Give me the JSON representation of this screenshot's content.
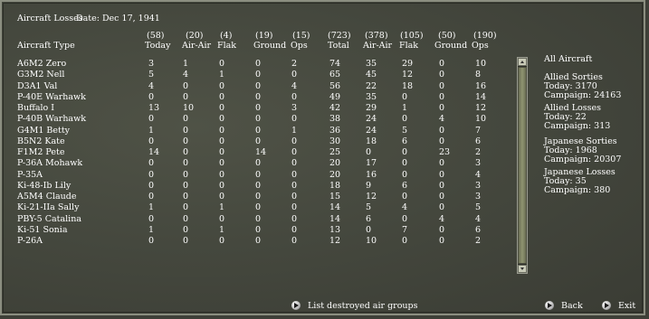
{
  "window": {
    "title": "Aircraft Losses",
    "date": "Date: Dec 17, 1941"
  },
  "columns": {
    "totals": [
      "(58)",
      "(20)",
      "(4)",
      "(19)",
      "(15)",
      "(723)",
      "(378)",
      "(105)",
      "(50)",
      "(190)"
    ],
    "labels": [
      "Aircraft Type",
      "Today",
      "Air-Air",
      "Flak",
      "Ground",
      "Ops",
      "Total",
      "Air-Air",
      "Flak",
      "Ground",
      "Ops"
    ]
  },
  "rows": [
    [
      "A6M2 Zero",
      "3",
      "1",
      "0",
      "0",
      "2",
      "74",
      "35",
      "29",
      "0",
      "10"
    ],
    [
      "G3M2 Nell",
      "5",
      "4",
      "1",
      "0",
      "0",
      "65",
      "45",
      "12",
      "0",
      "8"
    ],
    [
      "D3A1 Val",
      "4",
      "0",
      "0",
      "0",
      "4",
      "56",
      "22",
      "18",
      "0",
      "16"
    ],
    [
      "P-40E Warhawk",
      "0",
      "0",
      "0",
      "0",
      "0",
      "49",
      "35",
      "0",
      "0",
      "14"
    ],
    [
      "Buffalo I",
      "13",
      "10",
      "0",
      "0",
      "3",
      "42",
      "29",
      "1",
      "0",
      "12"
    ],
    [
      "P-40B Warhawk",
      "0",
      "0",
      "0",
      "0",
      "0",
      "38",
      "24",
      "0",
      "4",
      "10"
    ],
    [
      "G4M1 Betty",
      "1",
      "0",
      "0",
      "0",
      "1",
      "36",
      "24",
      "5",
      "0",
      "7"
    ],
    [
      "B5N2 Kate",
      "0",
      "0",
      "0",
      "0",
      "0",
      "30",
      "18",
      "6",
      "0",
      "6"
    ],
    [
      "F1M2 Pete",
      "14",
      "0",
      "0",
      "14",
      "0",
      "25",
      "0",
      "0",
      "23",
      "2"
    ],
    [
      "P-36A Mohawk",
      "0",
      "0",
      "0",
      "0",
      "0",
      "20",
      "17",
      "0",
      "0",
      "3"
    ],
    [
      "P-35A",
      "0",
      "0",
      "0",
      "0",
      "0",
      "20",
      "16",
      "0",
      "0",
      "4"
    ],
    [
      "Ki-48-Ib Lily",
      "0",
      "0",
      "0",
      "0",
      "0",
      "18",
      "9",
      "6",
      "0",
      "3"
    ],
    [
      "A5M4 Claude",
      "0",
      "0",
      "0",
      "0",
      "0",
      "15",
      "12",
      "0",
      "0",
      "3"
    ],
    [
      "Ki-21-IIa Sally",
      "1",
      "0",
      "1",
      "0",
      "0",
      "14",
      "5",
      "4",
      "0",
      "5"
    ],
    [
      "PBY-5 Catalina",
      "0",
      "0",
      "0",
      "0",
      "0",
      "14",
      "6",
      "0",
      "4",
      "4"
    ],
    [
      "Ki-51 Sonia",
      "1",
      "0",
      "1",
      "0",
      "0",
      "13",
      "0",
      "7",
      "0",
      "6"
    ],
    [
      "P-26A",
      "0",
      "0",
      "0",
      "0",
      "0",
      "12",
      "10",
      "0",
      "0",
      "2"
    ]
  ],
  "side_panel": {
    "heading": "All Aircraft",
    "allied_sorties": {
      "title": "Allied Sorties",
      "today": "Today:   3170",
      "campaign": "Campaign: 24163"
    },
    "allied_losses": {
      "title": "Allied Losses",
      "today": "Today:   22",
      "campaign": "Campaign: 313"
    },
    "japanese_sorties": {
      "title": "Japanese Sorties",
      "today": "Today:   1968",
      "campaign": "Campaign: 20307"
    },
    "japanese_losses": {
      "title": "Japanese Losses",
      "today": "Today:   35",
      "campaign": "Campaign: 380"
    }
  },
  "buttons": {
    "list_destroyed": "List destroyed air groups",
    "back": "Back",
    "exit": "Exit"
  },
  "colors": {
    "header_yellow": "#f3e43a",
    "text": "#ffffff",
    "background": "#45483e"
  },
  "icons": {
    "button_icon": "arrow-circle-icon"
  }
}
